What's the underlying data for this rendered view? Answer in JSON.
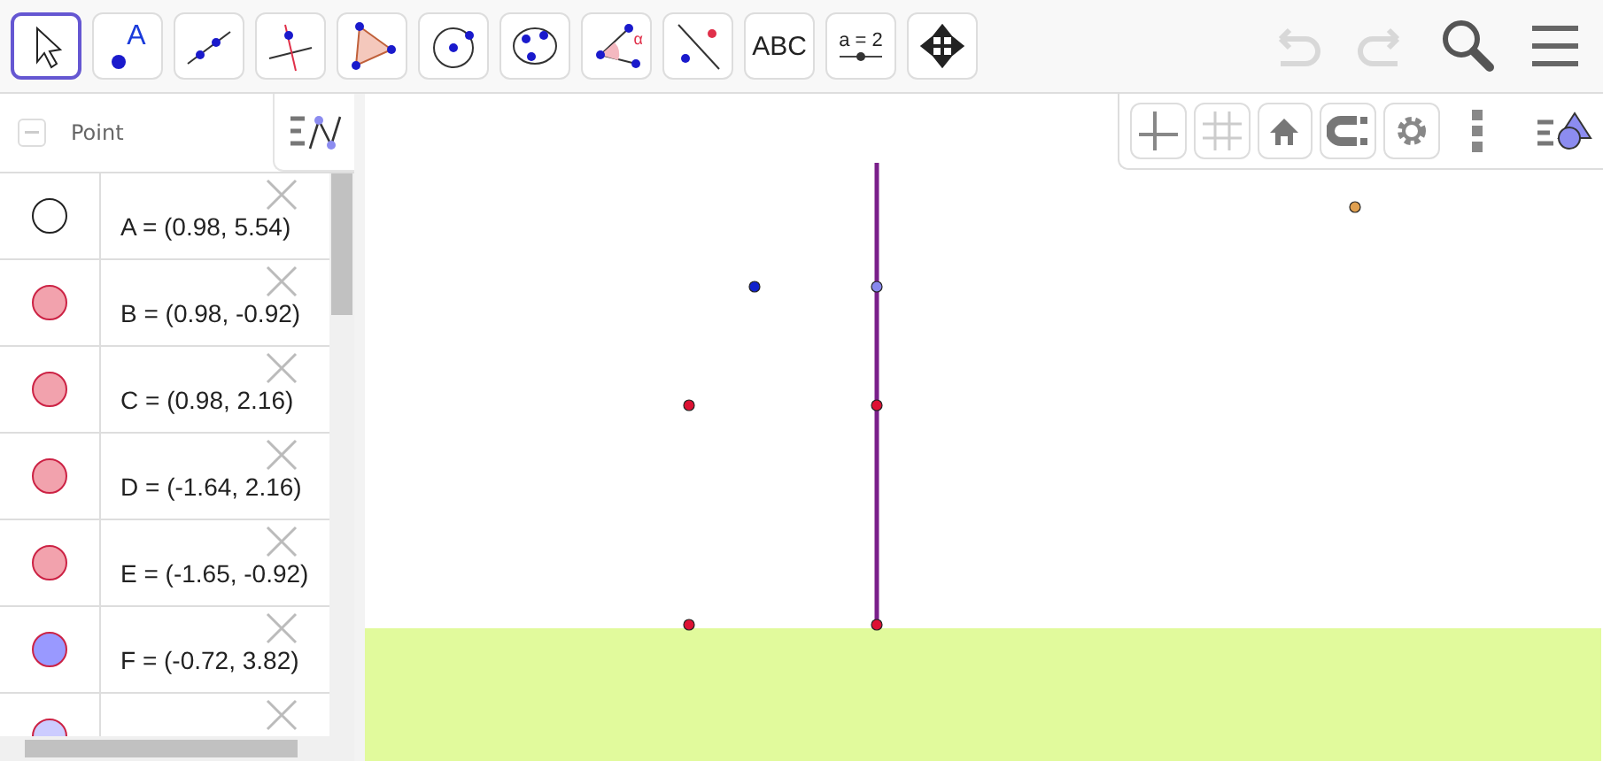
{
  "toolbar": {
    "tools": [
      {
        "kind": "move",
        "selected": true
      },
      {
        "kind": "point",
        "label": "A",
        "selected": false
      },
      {
        "kind": "line",
        "selected": false
      },
      {
        "kind": "perpendicular",
        "selected": false
      },
      {
        "kind": "polygon",
        "selected": false
      },
      {
        "kind": "circle",
        "selected": false
      },
      {
        "kind": "conic",
        "selected": false
      },
      {
        "kind": "angle",
        "label": "α",
        "selected": false
      },
      {
        "kind": "reflect",
        "selected": false
      },
      {
        "kind": "text",
        "label": "ABC",
        "selected": false
      },
      {
        "kind": "slider",
        "label": "a = 2",
        "selected": false
      },
      {
        "kind": "pan",
        "selected": false
      }
    ]
  },
  "algebra": {
    "header": "Point",
    "rows": [
      {
        "text": "A = (0.98, 5.54)",
        "visible": false,
        "color": "#ffffff"
      },
      {
        "text": "B = (0.98, -0.92)",
        "visible": true,
        "color": "#f2a2ad"
      },
      {
        "text": "C = (0.98, 2.16)",
        "visible": true,
        "color": "#f2a2ad"
      },
      {
        "text": "D = (-1.64, 2.16)",
        "visible": true,
        "color": "#f2a2ad"
      },
      {
        "text": "E = (-1.65, -0.92)",
        "visible": true,
        "color": "#f2a2ad"
      },
      {
        "text": "F = (-0.72, 3.82)",
        "visible": true,
        "color": "#9999ff"
      },
      {
        "visible": true,
        "color": "#ccccff"
      }
    ]
  }
}
